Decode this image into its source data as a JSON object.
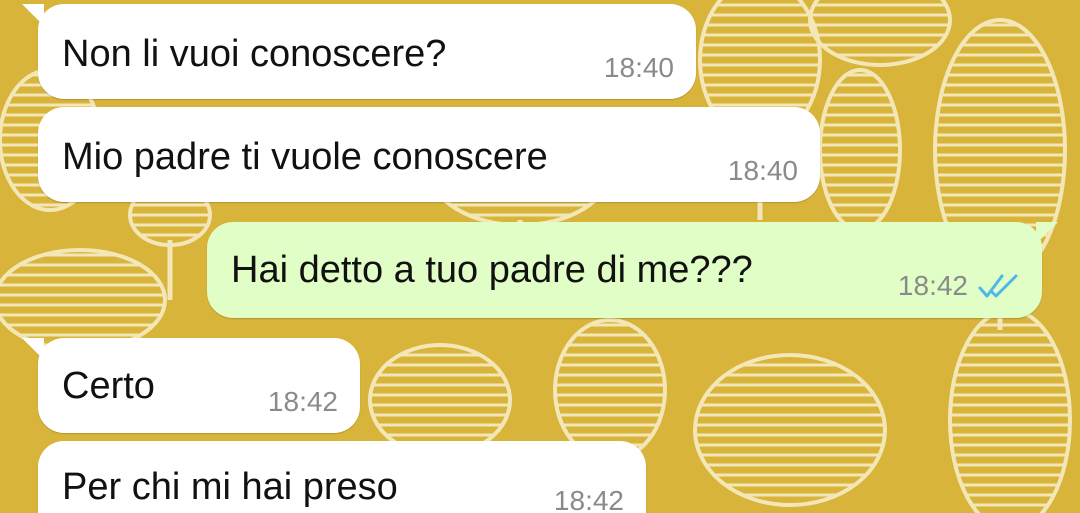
{
  "theme": {
    "wallpaper_color": "#d9b43a",
    "leaf_color": "#f3e7b7",
    "incoming_bubble": "#ffffff",
    "outgoing_bubble": "#e1fec6",
    "read_tick_color": "#4fb6ec"
  },
  "messages": [
    {
      "direction": "incoming",
      "text": "Non li vuoi conoscere?",
      "time": "18:40"
    },
    {
      "direction": "incoming",
      "text": "Mio padre ti vuole conoscere",
      "time": "18:40"
    },
    {
      "direction": "outgoing",
      "text": "Hai detto a tuo padre di me???",
      "time": "18:42",
      "status_icon": "double-check-read-icon"
    },
    {
      "direction": "incoming",
      "text": "Certo",
      "time": "18:42"
    },
    {
      "direction": "incoming",
      "text": "Per chi mi hai preso",
      "time": "18:42"
    }
  ]
}
